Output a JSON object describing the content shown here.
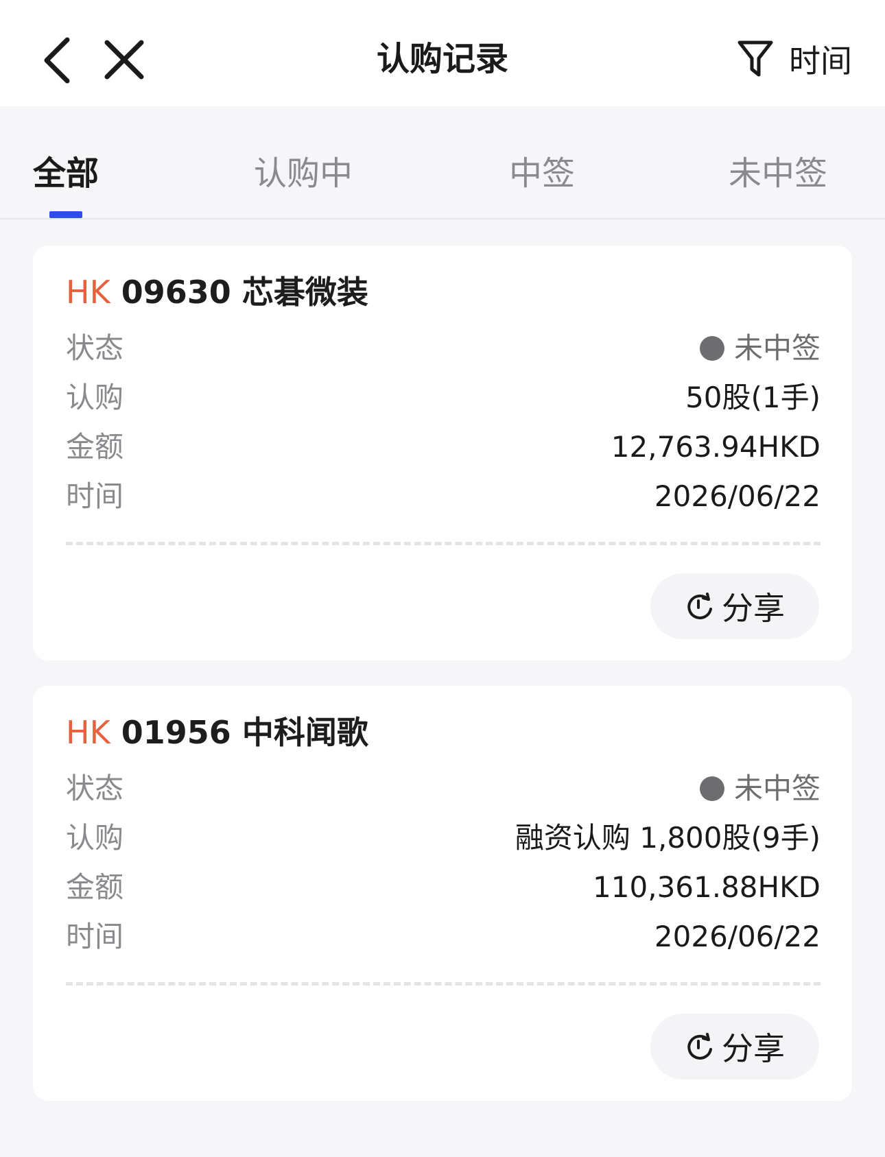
{
  "header": {
    "title": "认购记录",
    "filter_label": "时间",
    "back_icon": "chevron-left-icon",
    "close_icon": "close-icon",
    "filter_icon": "funnel-icon"
  },
  "tabs": [
    {
      "label": "全部",
      "active": true
    },
    {
      "label": "认购中",
      "active": false
    },
    {
      "label": "中签",
      "active": false
    },
    {
      "label": "未中签",
      "active": false
    }
  ],
  "records": [
    {
      "market": "HK",
      "code_name": "09630 芯碁微装",
      "rows": [
        {
          "label": "状态",
          "value": "未中签"
        },
        {
          "label": "认购",
          "value": "50股(1手)"
        },
        {
          "label": "金额",
          "value": "12,763.94HKD"
        },
        {
          "label": "时间",
          "value": "2026/06/22"
        }
      ],
      "share_label": "分享"
    },
    {
      "market": "HK",
      "code_name": "01956 中科闻歌",
      "rows": [
        {
          "label": "状态",
          "value": "未中签"
        },
        {
          "label": "认购",
          "value": "融资认购 1,800股(9手)"
        },
        {
          "label": "金额",
          "value": "110,361.88HKD"
        },
        {
          "label": "时间",
          "value": "2026/06/22"
        }
      ],
      "share_label": "分享"
    }
  ],
  "colors": {
    "accent": "#2f4fe0",
    "market": "#e5623f",
    "status_grey": "#6d6d70"
  }
}
